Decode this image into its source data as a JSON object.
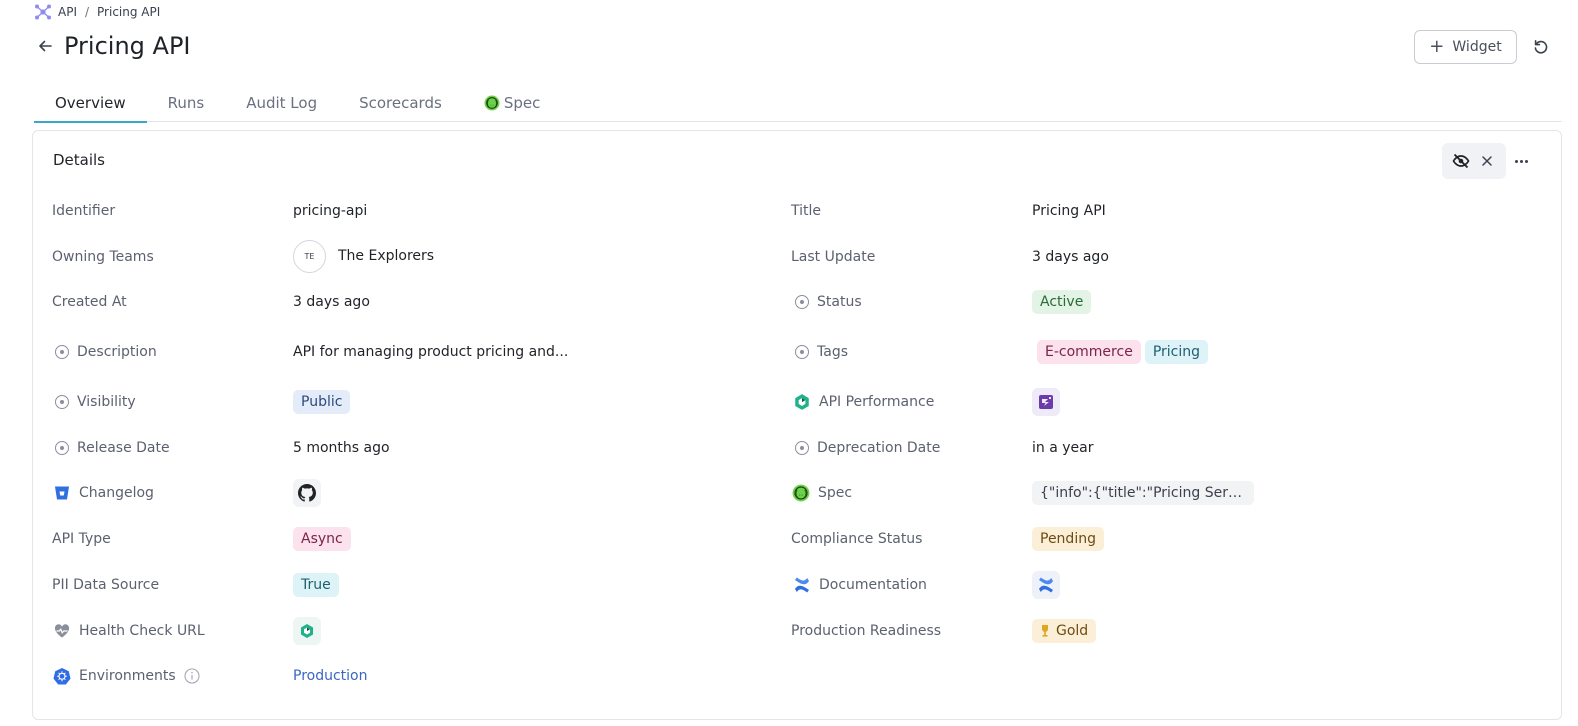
{
  "breadcrumb": {
    "root": "API",
    "current": "Pricing API",
    "separator": "/"
  },
  "page": {
    "title": "Pricing API"
  },
  "toolbar": {
    "widget_label": "Widget"
  },
  "tabs": [
    {
      "label": "Overview"
    },
    {
      "label": "Runs"
    },
    {
      "label": "Audit Log"
    },
    {
      "label": "Scorecards"
    },
    {
      "label": "Spec"
    }
  ],
  "card": {
    "title": "Details"
  },
  "details": {
    "identifier": {
      "label": "Identifier",
      "value": "pricing-api"
    },
    "title": {
      "label": "Title",
      "value": "Pricing API"
    },
    "owning_teams": {
      "label": "Owning Teams",
      "avatar": "TE",
      "value": "The Explorers"
    },
    "last_update": {
      "label": "Last Update",
      "value": "3 days ago"
    },
    "created_at": {
      "label": "Created At",
      "value": "3 days ago"
    },
    "status": {
      "label": "Status",
      "value": "Active"
    },
    "description": {
      "label": "Description",
      "value": "API for managing product pricing and..."
    },
    "tags": {
      "label": "Tags",
      "values": [
        "E-commerce",
        "Pricing"
      ]
    },
    "visibility": {
      "label": "Visibility",
      "value": "Public"
    },
    "api_performance": {
      "label": "API Performance"
    },
    "release_date": {
      "label": "Release Date",
      "value": "5 months ago"
    },
    "deprecation_date": {
      "label": "Deprecation Date",
      "value": "in a year"
    },
    "changelog": {
      "label": "Changelog"
    },
    "spec": {
      "label": "Spec",
      "value": "{\"info\":{\"title\":\"Pricing Service A..."
    },
    "api_type": {
      "label": "API Type",
      "value": "Async"
    },
    "compliance_status": {
      "label": "Compliance Status",
      "value": "Pending"
    },
    "pii_data_source": {
      "label": "PII Data Source",
      "value": "True"
    },
    "documentation": {
      "label": "Documentation"
    },
    "health_check_url": {
      "label": "Health Check URL"
    },
    "production_readiness": {
      "label": "Production Readiness",
      "value": "Gold"
    },
    "environments": {
      "label": "Environments",
      "value": "Production"
    }
  },
  "colors": {
    "accent": "#3ba7c8",
    "link": "#3b66c4"
  }
}
